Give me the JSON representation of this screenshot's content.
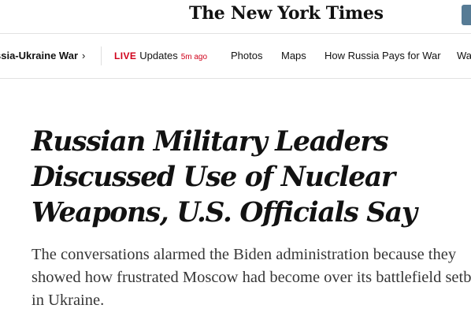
{
  "masthead": {
    "logo_text": "The New York Times"
  },
  "nav": {
    "primary_label": "ssia-Ukraine War",
    "primary_chevron": "›",
    "live_badge": "LIVE",
    "live_label": "Updates",
    "live_time": "5m ago",
    "items": [
      {
        "label": "Photos"
      },
      {
        "label": "Maps"
      },
      {
        "label": "How Russia Pays for War"
      },
      {
        "label": "Wa"
      }
    ]
  },
  "article": {
    "headline": "Russian Military Leaders Discussed Use of Nuclear Weapons, U.S. Officials Say",
    "summary": "The conversations alarmed the Biden administration because they showed how frustrated Moscow had become over its battlefield setbacks in Ukraine."
  },
  "colors": {
    "live": "#d0021b",
    "text": "#121212",
    "summary": "#363636",
    "header_button": "#567b95"
  }
}
